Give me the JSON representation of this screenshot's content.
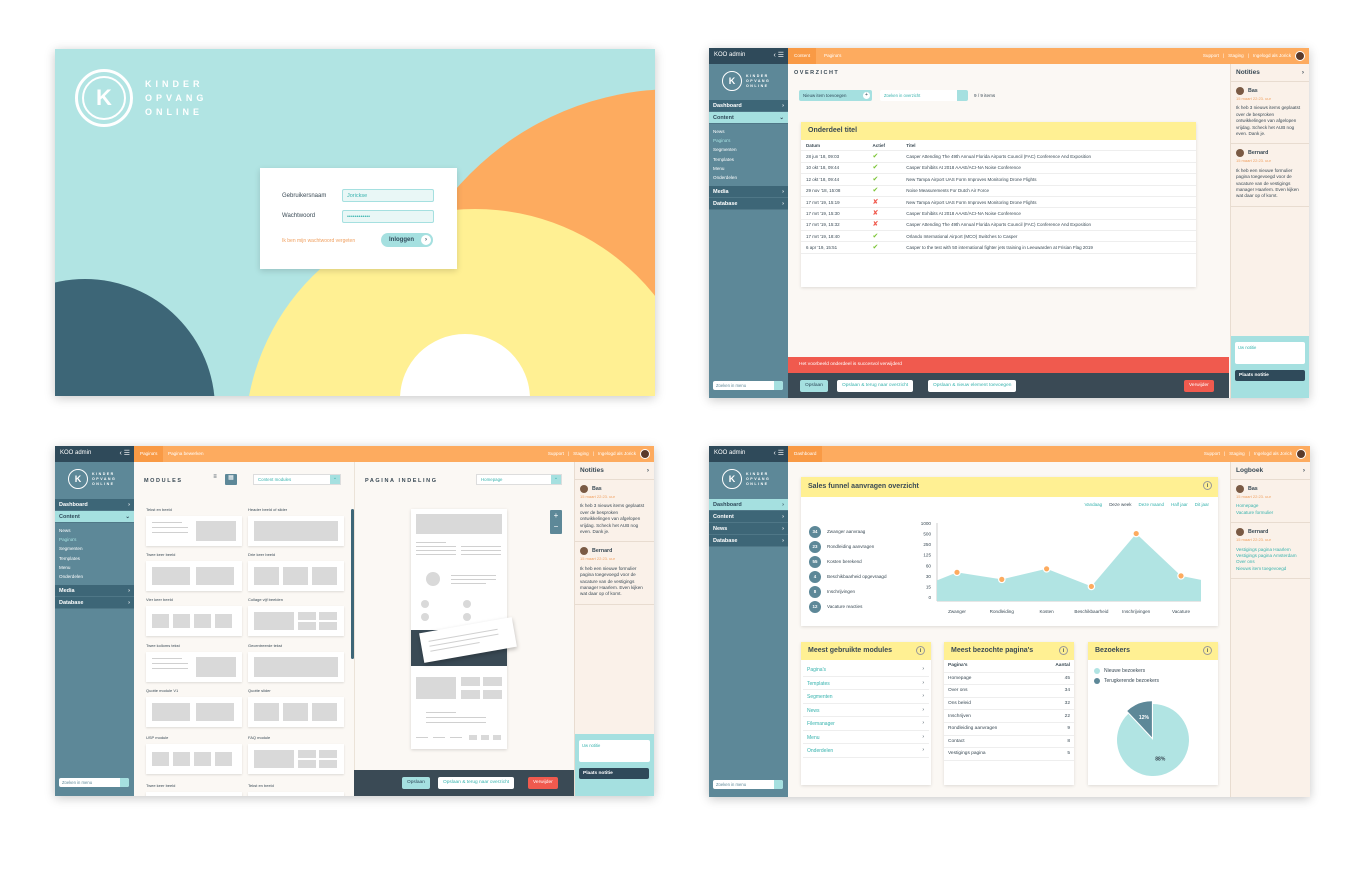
{
  "colors": {
    "teal": "#b1e4e3",
    "orange": "#fdab5f",
    "yellow": "#fff093",
    "navy": "#3d6677",
    "red": "#f05a4e"
  },
  "login": {
    "logo_letter": "K",
    "logo_lines": [
      "KINDER",
      "OPVANG",
      "ONLINE"
    ],
    "username_label": "Gebruikersnaam",
    "username_value": "Jorickse",
    "password_label": "Wachtwoord",
    "password_value": "••••••••••••",
    "forgot": "Ik ben mijn wachtwoord vergeten",
    "login_button": "Inloggen"
  },
  "admin": {
    "title": "KOO admin",
    "logo_letter": "K",
    "logo_lines": [
      "KINDER",
      "OPVANG",
      "ONLINE"
    ],
    "support": "Support",
    "staging": "Staging",
    "logged_in": "Ingelogd als Jorick",
    "search_menu": "Zoeken in menu",
    "nav": {
      "dashboard": "Dashboard",
      "content": "Content",
      "media": "Media",
      "database": "Database",
      "news": "News"
    },
    "sub": [
      "News",
      "Pagina's",
      "Segmenten",
      "Templates",
      "Menu",
      "Onderdelen"
    ]
  },
  "overview": {
    "tabs": [
      "Content",
      "Pagina's"
    ],
    "heading": "OVERZICHT",
    "new_item": "Nieuw item toevoegen",
    "search_placeholder": "Zoeken in overzicht",
    "count": "9 / 9 items",
    "card_title": "Onderdeel titel",
    "columns": [
      "Datum",
      "Actief",
      "Titel"
    ],
    "rows": [
      {
        "date": "28 jun '18, 09:03",
        "active": "✔",
        "title": "Casper Attending The 49th Annual Florida Airports Council (FAC) Conference And Exposition"
      },
      {
        "date": "10 okt '18, 09:44",
        "active": "✔",
        "title": "Casper Exhibits At 2018 AAAE/ACI-NA Noise Conference"
      },
      {
        "date": "12 okt '18, 09:44",
        "active": "✔",
        "title": "New Tampa Airport UAS Form Improves Monitoring Drone Flights"
      },
      {
        "date": "29 nov '18, 15:08",
        "active": "✔",
        "title": "Noise Measurements For Dutch Air Force"
      },
      {
        "date": "17 mrt '19, 15:19",
        "active": "✘",
        "title": "New Tampa Airport UAS Form Improves Monitoring Drone Flights"
      },
      {
        "date": "17 mrt '19, 15:30",
        "active": "✘",
        "title": "Casper Exhibits At 2018 AAAE/ACI-NA Noise Conference"
      },
      {
        "date": "17 mrt '19, 15:32",
        "active": "✘",
        "title": "Casper Attending The 49th Annual Florida Airports Council (FAC) Conference And Exposition"
      },
      {
        "date": "17 mrt '19, 18:40",
        "active": "✔",
        "title": "Orlando International Airport (MCO) Switches to Casper"
      },
      {
        "date": "6 apr '19, 15:51",
        "active": "✔",
        "title": "Casper to the test with 50 international fighter jets training in Leeuwarden at Frisian Flag 2019"
      }
    ],
    "alert": "Het voorbeeld onderdeel is succesvol verwijderd",
    "save": "Opslaan",
    "save_back": "Opslaan & terug naar overzicht",
    "save_new": "Opslaan & nieuw element toevoegen",
    "delete": "Verwijder"
  },
  "notes": {
    "title": "Notities",
    "items": [
      {
        "name": "Bas",
        "date": "15 maart 22:23. uur",
        "text": "Ik heb 3 nieuws items geplaatst over de besproken ontwikkelingen van afgelopen vrijdag. Scheck het AUB nog even. Dank je."
      },
      {
        "name": "Bernard",
        "date": "15 maart 22:23. uur",
        "text": "Ik heb een nieuwe formulier pagina toegevoegd voor de vacature van de vestigings manager Haarlem. Even kijken wat daar op of komt."
      }
    ],
    "your_note": "Uw notitie",
    "place": "Plaats notitie"
  },
  "editor": {
    "tabs": [
      "Pagina's",
      "Pagina bewerken"
    ],
    "modules_heading": "MODULES",
    "modules_select": "Content modules",
    "layout_heading": "PAGINA INDELING",
    "layout_select": "Homepage",
    "modules": [
      "Tekst en beeld",
      "Header beeld of slider",
      "Twee keer beeld",
      "Drie keer beeld",
      "Vier keer beeld",
      "Collage vijf beelden",
      "Twee kolloms tekst",
      "Gecentreerde tekst",
      "Quotte module V1",
      "Quotte slider",
      "USP module",
      "FAQ module",
      "Twee keer beeld",
      "Tekst en beeld"
    ],
    "save": "Opslaan",
    "save_back": "Opslaan & terug naar overzicht",
    "delete": "Verwijder"
  },
  "dashboard": {
    "tab": "Dashboard",
    "funnel_title": "Sales funnel aanvragen overzicht",
    "ranges": [
      "Vandaag",
      "Deze week",
      "Deze maand",
      "Half jaar",
      "Dit jaar"
    ],
    "funnel": [
      {
        "n": "34",
        "label": "Zwanger aanvraag"
      },
      {
        "n": "23",
        "label": "Rondleiding aanvragen"
      },
      {
        "n": "55",
        "label": "Kosten berekend"
      },
      {
        "n": "4",
        "label": "Beschikbaarheid opgevraagd"
      },
      {
        "n": "8",
        "label": "Inschrijvingen"
      },
      {
        "n": "12",
        "label": "Vacature reacties"
      }
    ],
    "modules_title": "Meest gebruikte modules",
    "modules": [
      "Pagina's",
      "Templates",
      "Segmenten",
      "News",
      "Filemanager",
      "Menu",
      "Onderdelen"
    ],
    "pages_title": "Meest bezochte pagina's",
    "pages_cols": [
      "Pagina's",
      "Aantal"
    ],
    "pages": [
      [
        "Homepage",
        "45"
      ],
      [
        "Over ons",
        "34"
      ],
      [
        "Ons beleid",
        "32"
      ],
      [
        "Inschrijven",
        "22"
      ],
      [
        "Rondleiding aanvragen",
        "9"
      ],
      [
        "Contact",
        "8"
      ],
      [
        "Vestigings pagina",
        "5"
      ]
    ],
    "visitors_title": "Bezoekers",
    "logbook_title": "Logboek",
    "log": [
      {
        "name": "Bas",
        "date": "15 maart 22:23. uur",
        "links": [
          "Homepage",
          "Vacature formulier"
        ]
      },
      {
        "name": "Bernard",
        "date": "15 maart 22:23. uur",
        "links": [
          "Vestigings pagina Haarlem",
          "Vestigings pagina Amsterdam",
          "Over ons",
          "Nieuws item toegevoegd"
        ]
      }
    ]
  },
  "chart_data": [
    {
      "type": "area",
      "title": "Sales funnel aanvragen overzicht",
      "categories": [
        "Zwanger",
        "Rondleiding",
        "Kosten",
        "Beschikbaarheid",
        "Inschrijvingen",
        "Vacature"
      ],
      "values": [
        40,
        25,
        50,
        15,
        500,
        30
      ],
      "yticks": [
        "1000",
        "500",
        "250",
        "125",
        "60",
        "30",
        "15",
        "0"
      ],
      "ylim": [
        0,
        1000
      ]
    },
    {
      "type": "pie",
      "title": "Bezoekers",
      "series": [
        {
          "name": "Nieuwe bezoekers",
          "value": 88,
          "label": "88%"
        },
        {
          "name": "Terugkerende bezoekers",
          "value": 12,
          "label": "12%"
        }
      ]
    }
  ]
}
